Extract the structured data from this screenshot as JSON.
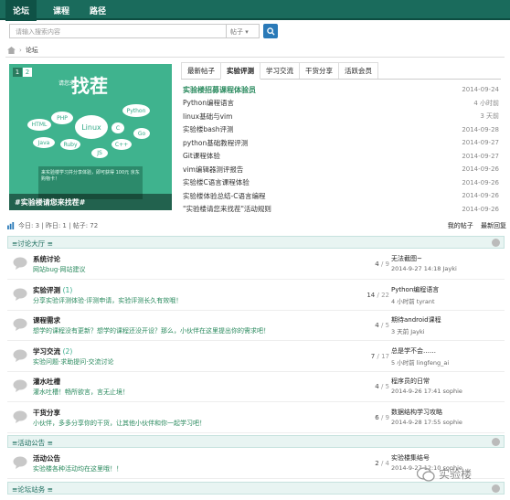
{
  "nav": {
    "items": [
      "论坛",
      "课程",
      "路径"
    ]
  },
  "search": {
    "placeholder": "请输入搜索内容",
    "scope": "帖子"
  },
  "breadcrumb": {
    "current": "论坛"
  },
  "banner": {
    "pages": [
      "1",
      "2"
    ],
    "headline": "找茬",
    "sub": "请您来",
    "badges": [
      "PHP",
      "HTML",
      "Linux",
      "Python",
      "Java",
      "Go",
      "C",
      "C++",
      "Ruby",
      "JS"
    ],
    "note": "来实验楼学习并分享体验，即可获得 100元 京东购物卡！",
    "caption": "#实验楼请您来找茬#"
  },
  "tabs": [
    "最新帖子",
    "实验评测",
    "学习交流",
    "干货分享",
    "活跃会员"
  ],
  "articles": [
    {
      "t": "实验楼招募课程体验员",
      "d": "2014-09-24"
    },
    {
      "t": "Python编程语言",
      "d": "4 小时前"
    },
    {
      "t": "linux基础与vim",
      "d": "3 天前"
    },
    {
      "t": "实验楼bash评测",
      "d": "2014-09-28"
    },
    {
      "t": "python基础教程评测",
      "d": "2014-09-27"
    },
    {
      "t": "Git课程体验",
      "d": "2014-09-27"
    },
    {
      "t": "vim编辑器测评报告",
      "d": "2014-09-26"
    },
    {
      "t": "实验楼C语言课程体验",
      "d": "2014-09-26"
    },
    {
      "t": "实验楼体验总结-C语言编程",
      "d": "2014-09-26"
    },
    {
      "t": "\"实验楼请您来找茬\"活动规则",
      "d": "2014-09-26"
    }
  ],
  "stats": {
    "left": "今日: 3 | 昨日: 1 | 帖子: 72",
    "mine": "我的帖子",
    "reply": "最新回复"
  },
  "sections": [
    {
      "title": "≡讨论大厅 ≡",
      "forums": [
        {
          "nm": "系统讨论",
          "c": "",
          "ds": "网站bug·网站建议",
          "n": "4",
          "m": "9",
          "lt": "无法截图~",
          "lm": "2014-9-27 14:18 Jayki"
        },
        {
          "nm": "实验评测",
          "c": "(1)",
          "ds": "分享实验评测体验·评测申请，实验评测长久有效哦！",
          "n": "14",
          "m": "22",
          "lt": "Python编程语言",
          "lm": "4 小时前 tyrant"
        },
        {
          "nm": "课程需求",
          "c": "",
          "ds": "想学的课程没有更新？想学的课程还没开设？那么，小伙伴在这里提出你的需求吧！",
          "n": "4",
          "m": "5",
          "lt": "期待android课程",
          "lm": "3 天前 Jayki"
        },
        {
          "nm": "学习交流",
          "c": "(2)",
          "ds": "实验问题·求助提问·交流讨论",
          "n": "7",
          "m": "17",
          "lt": "总是学不会……",
          "lm": "5 小时前 lingfeng_ai"
        },
        {
          "nm": "灌水吐槽",
          "c": "",
          "ds": "灌水吐槽！畅所欲言，言无止境！",
          "n": "4",
          "m": "5",
          "lt": "程序员的日常",
          "lm": "2014-9-26 17:41 sophie"
        },
        {
          "nm": "干货分享",
          "c": "",
          "ds": "小伙伴，多多分享你的干货，让其他小伙伴和你一起学习吧！",
          "n": "6",
          "m": "9",
          "lt": "数据结构学习攻略",
          "lm": "2014-9-28 17:55 sophie"
        }
      ]
    },
    {
      "title": "≡活动公告 ≡",
      "forums": [
        {
          "nm": "活动公告",
          "c": "",
          "ds": "实验楼各种活动均在这里哦！！",
          "n": "2",
          "m": "4",
          "lt": "实验楼集结号",
          "lm": "2014-9-27 12:10 sophie"
        }
      ]
    },
    {
      "title": "≡论坛站务 ≡",
      "forums": []
    }
  ],
  "watermark": "实验楼",
  "colors": {
    "nav": "#1a6b5c",
    "accent": "#2a8a5e",
    "banner": "#3fb38e"
  }
}
